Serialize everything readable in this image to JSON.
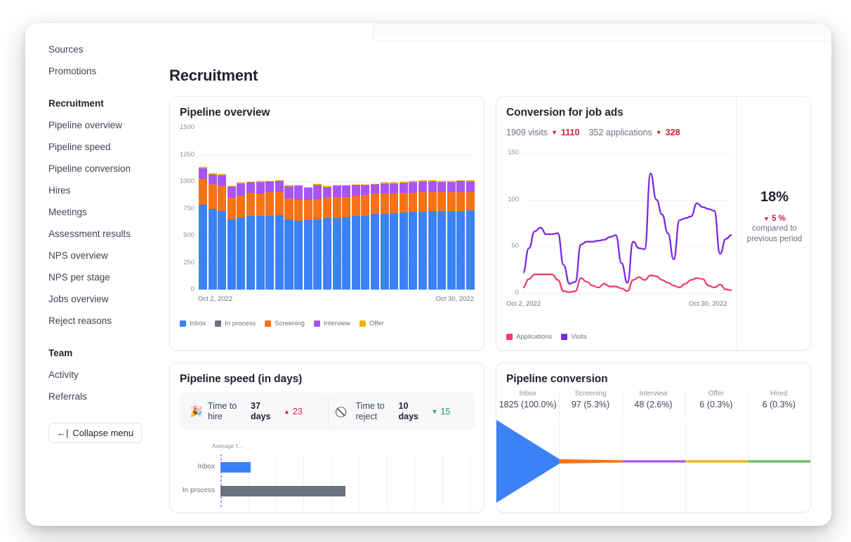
{
  "sidebar": {
    "items": [
      {
        "label": "Sources",
        "type": "item"
      },
      {
        "label": "Promotions",
        "type": "item"
      },
      {
        "label": "",
        "type": "gap"
      },
      {
        "label": "Recruitment",
        "type": "head"
      },
      {
        "label": "Pipeline overview",
        "type": "item"
      },
      {
        "label": "Pipeline speed",
        "type": "item"
      },
      {
        "label": "Pipeline conversion",
        "type": "item"
      },
      {
        "label": "Hires",
        "type": "item"
      },
      {
        "label": "Meetings",
        "type": "item"
      },
      {
        "label": "Assessment results",
        "type": "item"
      },
      {
        "label": "NPS overview",
        "type": "item"
      },
      {
        "label": "NPS per stage",
        "type": "item"
      },
      {
        "label": "Jobs overview",
        "type": "item"
      },
      {
        "label": "Reject reasons",
        "type": "item"
      },
      {
        "label": "",
        "type": "gap"
      },
      {
        "label": "Team",
        "type": "head"
      },
      {
        "label": "Activity",
        "type": "item"
      },
      {
        "label": "Referrals",
        "type": "item"
      }
    ],
    "collapse_label": "Collapse menu",
    "collapse_icon": "arrow-left-bar-icon",
    "collapse_glyph": "←|"
  },
  "page": {
    "title": "Recruitment"
  },
  "colors": {
    "inbox": "#3b82f6",
    "in_process": "#6b7280",
    "screening": "#f97316",
    "interview": "#a855f7",
    "offer": "#eab308",
    "hired": "#5cbb6a",
    "visits": "#7c28e8",
    "applications": "#f43f6e",
    "negative": "#d91f35",
    "positive": "#1e9e52"
  },
  "cards": {
    "pipeline_overview": {
      "title": "Pipeline overview",
      "x_start": "Oct 2, 2022",
      "x_end": "Oct 30, 2022",
      "legend": [
        {
          "label": "Inbox",
          "color": "#3b82f6"
        },
        {
          "label": "In process",
          "color": "#6b7280"
        },
        {
          "label": "Screening",
          "color": "#f97316"
        },
        {
          "label": "Interview",
          "color": "#a855f7"
        },
        {
          "label": "Offer",
          "color": "#eab308"
        }
      ]
    },
    "conversion": {
      "title": "Conversion for job ads",
      "visits_text": "1909 visits",
      "visits_delta": "1110",
      "applications_text": "352 applications",
      "applications_delta": "328",
      "delta_icon": "triangle-down-icon",
      "x_start": "Oct 2, 2022",
      "x_end": "Oct 30, 2022",
      "legend": [
        {
          "label": "Applications",
          "color": "#f43f6e"
        },
        {
          "label": "Visits",
          "color": "#7c28e8"
        }
      ],
      "kpi_value": "18%",
      "kpi_delta": "5 %",
      "kpi_note": "compared to previous period"
    },
    "pipeline_speed": {
      "title": "Pipeline speed (in days)",
      "metrics": [
        {
          "icon": "party-popper-icon",
          "glyph": "🎉",
          "label": "Time to hire",
          "value": "37 days",
          "change": "23",
          "direction": "up",
          "change_icon": "triangle-up-icon"
        },
        {
          "icon": "no-entry-icon",
          "glyph": "⃠",
          "label": "Time to reject",
          "value": "10 days",
          "change": "15",
          "direction": "down",
          "change_icon": "triangle-down-icon"
        }
      ],
      "chart_header": "Average f...",
      "rows": [
        {
          "label": "Inbox",
          "color": "#3b82f6",
          "value": 12
        },
        {
          "label": "In process",
          "color": "#6b7280",
          "value": 50
        }
      ]
    },
    "pipeline_conversion": {
      "title": "Pipeline conversion",
      "stages": [
        {
          "name": "Inbox",
          "value": "1825 (100.0%)",
          "color": "#3b82f6"
        },
        {
          "name": "Screening",
          "value": "97 (5.3%)",
          "color": "#f97316"
        },
        {
          "name": "Interview",
          "value": "48 (2.6%)",
          "color": "#a855f7"
        },
        {
          "name": "Offer",
          "value": "6 (0.3%)",
          "color": "#eab308"
        },
        {
          "name": "Hired",
          "value": "6 (0.3%)",
          "color": "#5cbb6a"
        }
      ]
    }
  },
  "chart_data": [
    {
      "id": "pipeline-overview",
      "type": "bar",
      "stacked": true,
      "title": "Pipeline overview",
      "xlabel": "",
      "ylabel": "",
      "ylim": [
        0,
        1500
      ],
      "yticks": [
        0,
        250,
        500,
        750,
        1000,
        1250,
        1500
      ],
      "grid": true,
      "legend_position": "bottom",
      "categories": [
        "Oct 2, 2022",
        "Oct 3, 2022",
        "Oct 4, 2022",
        "Oct 5, 2022",
        "Oct 6, 2022",
        "Oct 7, 2022",
        "Oct 8, 2022",
        "Oct 9, 2022",
        "Oct 10, 2022",
        "Oct 11, 2022",
        "Oct 12, 2022",
        "Oct 13, 2022",
        "Oct 14, 2022",
        "Oct 15, 2022",
        "Oct 16, 2022",
        "Oct 17, 2022",
        "Oct 18, 2022",
        "Oct 19, 2022",
        "Oct 20, 2022",
        "Oct 21, 2022",
        "Oct 22, 2022",
        "Oct 23, 2022",
        "Oct 24, 2022",
        "Oct 25, 2022",
        "Oct 26, 2022",
        "Oct 27, 2022",
        "Oct 28, 2022",
        "Oct 29, 2022",
        "Oct 30, 2022"
      ],
      "series": [
        {
          "name": "Inbox",
          "color": "#3b82f6",
          "values": [
            785,
            748,
            728,
            648,
            666,
            684,
            683,
            685,
            688,
            648,
            634,
            646,
            652,
            660,
            665,
            668,
            680,
            684,
            700,
            700,
            706,
            712,
            718,
            722,
            726,
            728,
            730,
            728,
            736
          ]
        },
        {
          "name": "In process",
          "color": "#6b7280",
          "values": [
            0,
            0,
            0,
            0,
            0,
            0,
            0,
            0,
            0,
            0,
            0,
            0,
            0,
            0,
            0,
            0,
            0,
            0,
            0,
            0,
            0,
            0,
            0,
            0,
            0,
            0,
            0,
            0,
            0
          ]
        },
        {
          "name": "Screening",
          "color": "#f97316",
          "values": [
            240,
            225,
            232,
            200,
            207,
            213,
            207,
            220,
            218,
            198,
            200,
            184,
            188,
            188,
            190,
            192,
            190,
            190,
            188,
            190,
            186,
            185,
            180,
            182,
            178,
            172,
            170,
            176,
            164
          ]
        },
        {
          "name": "Interview",
          "color": "#a855f7",
          "values": [
            98,
            92,
            100,
            106,
            110,
            96,
            104,
            92,
            100,
            110,
            125,
            110,
            130,
            102,
            105,
            100,
            96,
            92,
            84,
            92,
            90,
            92,
            96,
            96,
            96,
            94,
            96,
            100,
            100
          ]
        },
        {
          "name": "Offer",
          "color": "#eab308",
          "values": [
            15,
            12,
            10,
            10,
            12,
            10,
            12,
            10,
            10,
            10,
            8,
            10,
            10,
            10,
            10,
            10,
            10,
            10,
            10,
            12,
            12,
            12,
            12,
            12,
            12,
            12,
            12,
            12,
            12
          ]
        }
      ]
    },
    {
      "id": "conversion-job-ads",
      "type": "line",
      "title": "Conversion for job ads",
      "xlabel": "",
      "ylabel": "",
      "ylim": [
        0,
        150
      ],
      "yticks": [
        0,
        50,
        100,
        150
      ],
      "grid": true,
      "legend_position": "bottom",
      "x_start": "Oct 2, 2022",
      "x_end": "Oct 30, 2022",
      "series": [
        {
          "name": "Visits",
          "color": "#7c28e8",
          "values": [
            22,
            48,
            66,
            70,
            63,
            63,
            64,
            30,
            10,
            12,
            52,
            55,
            55,
            56,
            57,
            60,
            62,
            32,
            11,
            55,
            48,
            47,
            128,
            100,
            84,
            64,
            36,
            78,
            80,
            82,
            96,
            92,
            90,
            88,
            42,
            58,
            62
          ]
        },
        {
          "name": "Applications",
          "color": "#f43f6e",
          "values": [
            6,
            15,
            20,
            20,
            20,
            20,
            14,
            2,
            1,
            2,
            16,
            12,
            8,
            6,
            10,
            7,
            7,
            5,
            2,
            14,
            17,
            14,
            19,
            18,
            14,
            11,
            8,
            6,
            10,
            14,
            16,
            15,
            8,
            6,
            9,
            4,
            3
          ]
        }
      ]
    },
    {
      "id": "pipeline-speed",
      "type": "bar",
      "orientation": "horizontal",
      "title": "Pipeline speed (in days)",
      "categories": [
        "Inbox",
        "In process"
      ],
      "values": [
        12,
        50
      ],
      "colors": [
        "#3b82f6",
        "#6b7280"
      ],
      "xlim": [
        0,
        100
      ],
      "grid": true
    },
    {
      "id": "pipeline-conversion",
      "type": "funnel",
      "title": "Pipeline conversion",
      "stages": [
        "Inbox",
        "Screening",
        "Interview",
        "Offer",
        "Hired"
      ],
      "values": [
        1825,
        97,
        48,
        6,
        6
      ],
      "percentages": [
        "100.0%",
        "5.3%",
        "2.6%",
        "0.3%",
        "0.3%"
      ],
      "colors": [
        "#3b82f6",
        "#f97316",
        "#a855f7",
        "#eab308",
        "#5cbb6a"
      ]
    }
  ]
}
